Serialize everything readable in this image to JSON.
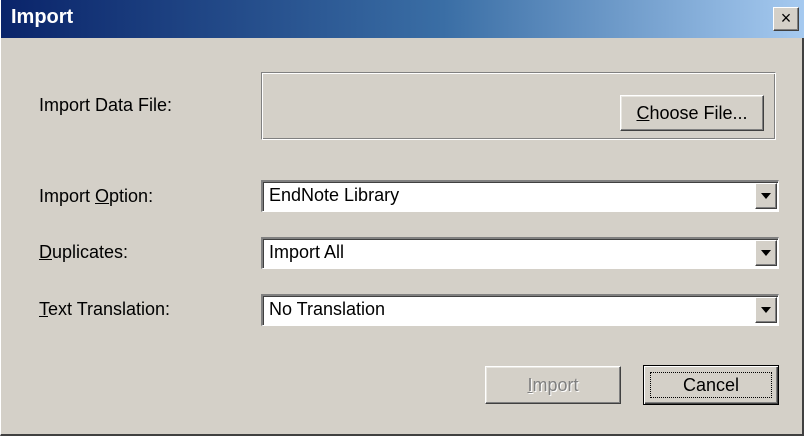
{
  "window": {
    "title": "Import",
    "close_glyph": "×"
  },
  "fields": {
    "import_data_file_label": "Import Data File:",
    "choose_file_button": {
      "mnemonic": "C",
      "rest": "hoose File..."
    },
    "import_option": {
      "label_before": "Import ",
      "label_mnemonic": "O",
      "label_after": "ption:",
      "value": "EndNote Library"
    },
    "duplicates": {
      "label_mnemonic": "D",
      "label_after": "uplicates:",
      "value": "Import All"
    },
    "text_translation": {
      "label_mnemonic": "T",
      "label_after": "ext Translation:",
      "value": "No Translation"
    }
  },
  "buttons": {
    "import": {
      "mnemonic": "I",
      "rest": "mport",
      "enabled": false
    },
    "cancel": {
      "label": "Cancel"
    }
  },
  "colors": {
    "dialog_face": "#d4d0c8",
    "titlebar_start": "#0a246a",
    "titlebar_end": "#a6caf0",
    "disabled_text": "#808080"
  },
  "icons": {
    "close": "close-icon",
    "dropdown": "chevron-down-icon"
  }
}
